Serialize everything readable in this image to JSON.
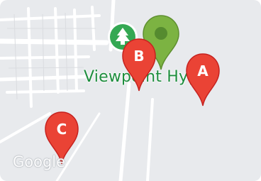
{
  "map": {
    "poi_label": "Viewpoint Hygro",
    "logo_text": "Google",
    "markers": [
      {
        "id": "a",
        "label": "A",
        "color": "#ea4335"
      },
      {
        "id": "b",
        "label": "B",
        "color": "#ea4335"
      },
      {
        "id": "c",
        "label": "C",
        "color": "#ea4335"
      }
    ],
    "place_pin_color": "#7cb342",
    "park_icon_color": "#34a853"
  }
}
